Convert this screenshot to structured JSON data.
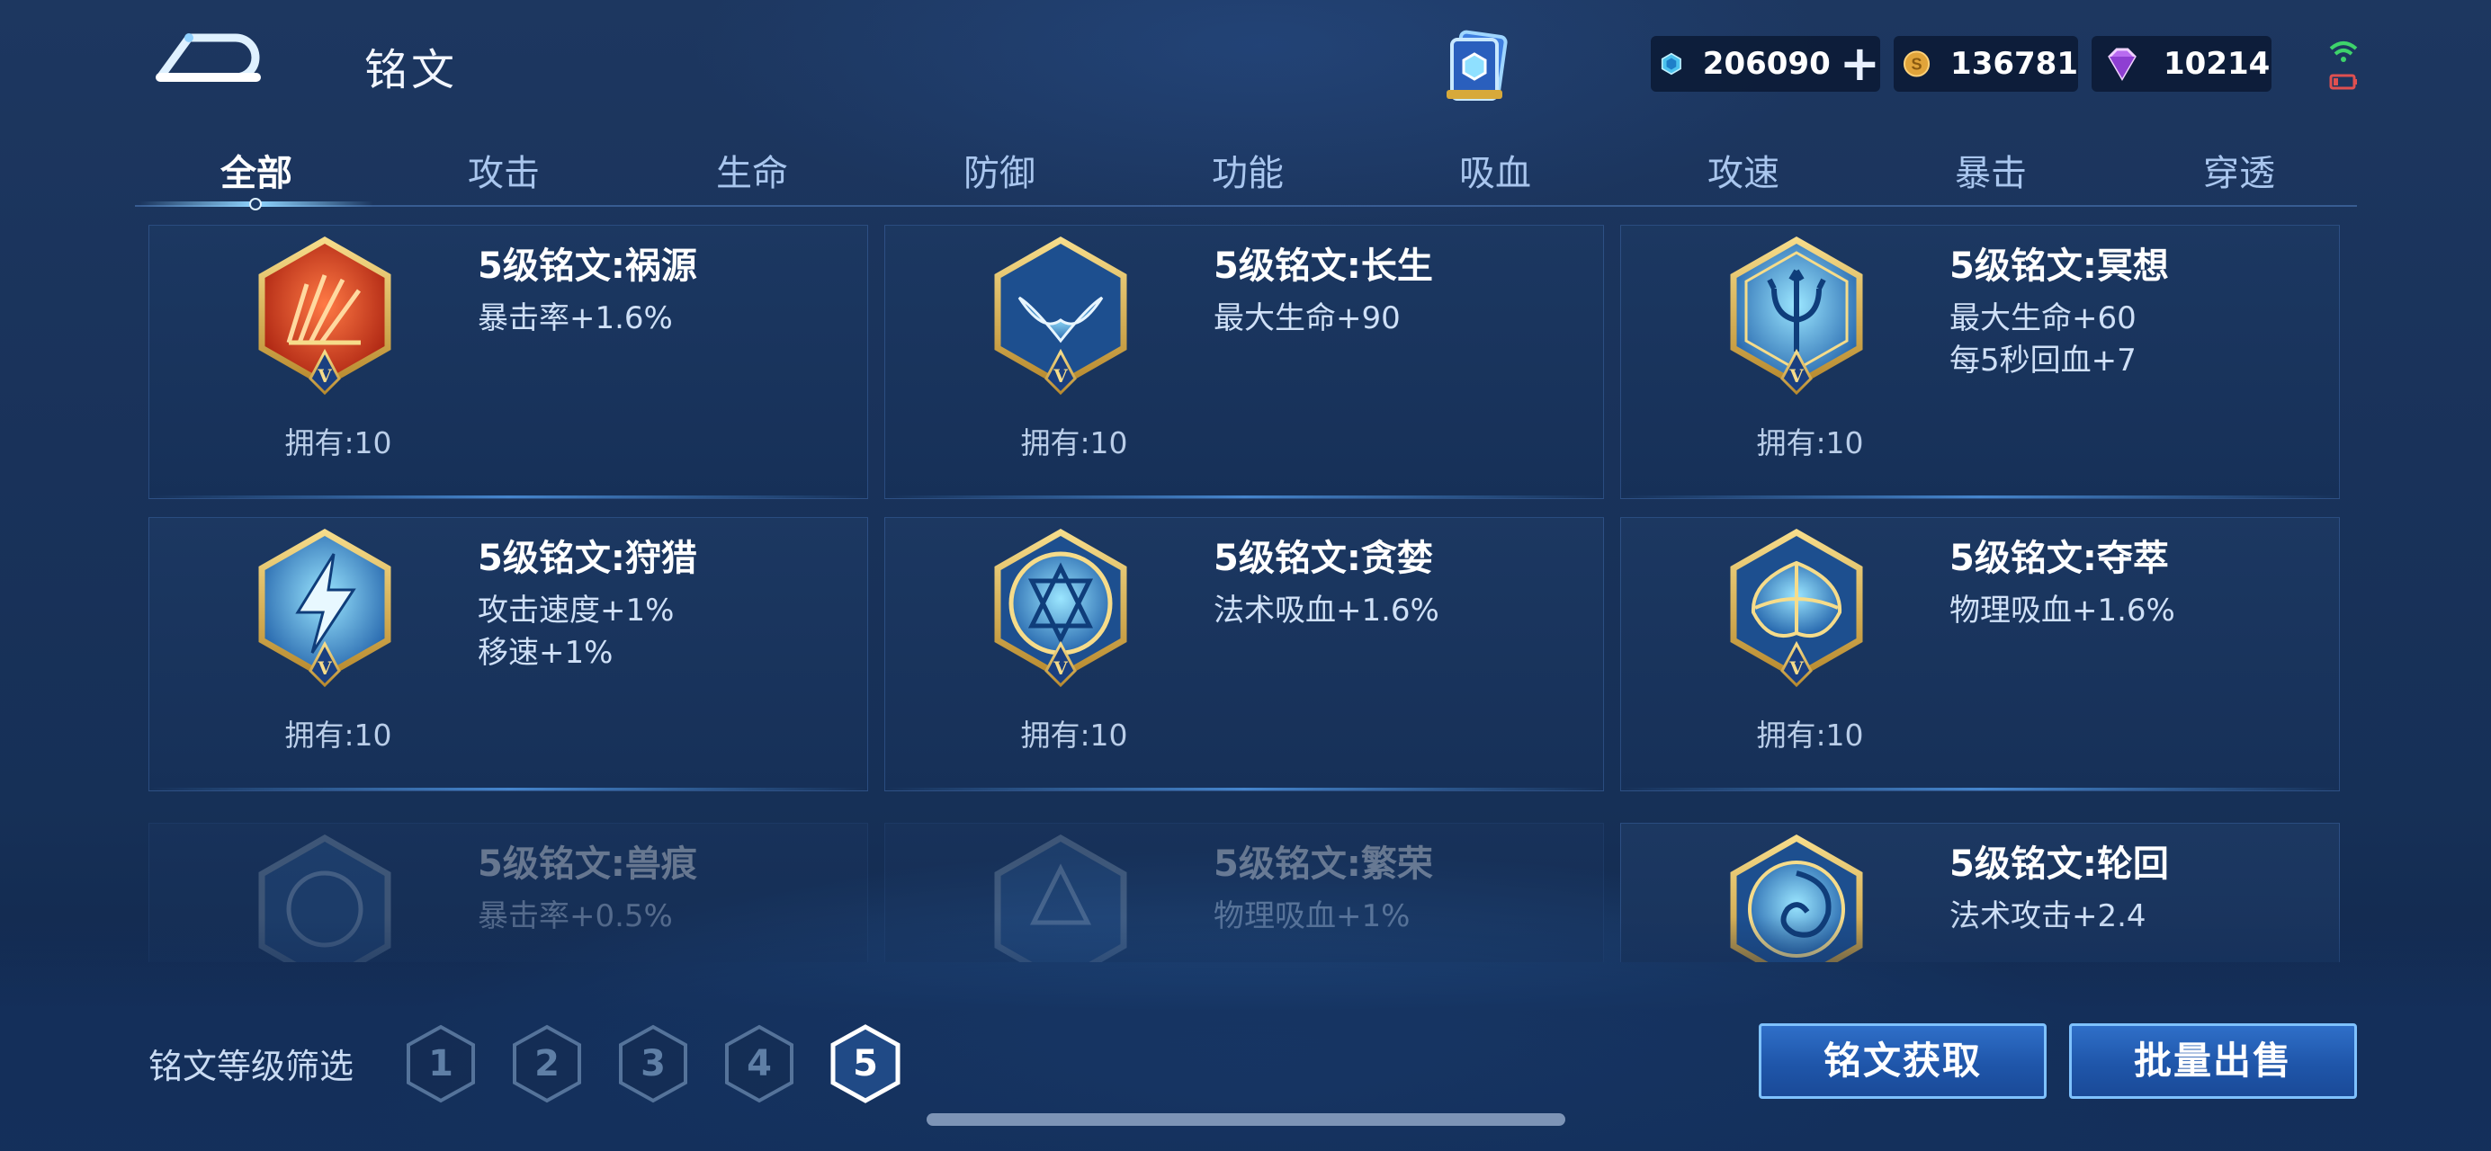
{
  "header": {
    "title": "铭文",
    "currencies": [
      {
        "icon": "diamond-coupon-icon",
        "value": "206090",
        "has_plus": true
      },
      {
        "icon": "gold-coin-icon",
        "value": "136781"
      },
      {
        "icon": "purple-gem-icon",
        "value": "10214"
      }
    ]
  },
  "tabs": [
    "全部",
    "攻击",
    "生命",
    "防御",
    "功能",
    "吸血",
    "攻速",
    "暴击",
    "穿透"
  ],
  "active_tab": "全部",
  "cards": [
    {
      "name": "5级铭文:祸源",
      "stats": [
        "暴击率+1.6%"
      ],
      "owned": "拥有:10",
      "emblem": "red-fan-emblem-icon"
    },
    {
      "name": "5级铭文:长生",
      "stats": [
        "最大生命+90"
      ],
      "owned": "拥有:10",
      "emblem": "blue-whale-tail-emblem-icon"
    },
    {
      "name": "5级铭文:冥想",
      "stats": [
        "最大生命+60",
        "每5秒回血+7"
      ],
      "owned": "拥有:10",
      "emblem": "blue-trident-emblem-icon"
    },
    {
      "name": "5级铭文:狩猎",
      "stats": [
        "攻击速度+1%",
        "移速+1%"
      ],
      "owned": "拥有:10",
      "emblem": "blue-lightning-emblem-icon"
    },
    {
      "name": "5级铭文:贪婪",
      "stats": [
        "法术吸血+1.6%"
      ],
      "owned": "拥有:10",
      "emblem": "blue-star-circle-emblem-icon"
    },
    {
      "name": "5级铭文:夺萃",
      "stats": [
        "物理吸血+1.6%"
      ],
      "owned": "拥有:10",
      "emblem": "blue-leaf-emblem-icon"
    },
    {
      "name": "5级铭文:兽痕",
      "stats": [
        "暴击率+0.5%"
      ],
      "owned": "",
      "emblem": "faded-emblem-icon"
    },
    {
      "name": "5级铭文:繁荣",
      "stats": [
        "物理吸血+1%"
      ],
      "owned": "",
      "emblem": "faded-emblem-icon"
    },
    {
      "name": "5级铭文:轮回",
      "stats": [
        "法术攻击+2.4"
      ],
      "owned": "",
      "emblem": "blue-swirl-emblem-icon"
    }
  ],
  "filter": {
    "label": "铭文等级筛选",
    "levels": [
      "1",
      "2",
      "3",
      "4",
      "5"
    ],
    "selected": "5"
  },
  "buttons": {
    "obtain": "铭文获取",
    "bulk_sell": "批量出售"
  }
}
